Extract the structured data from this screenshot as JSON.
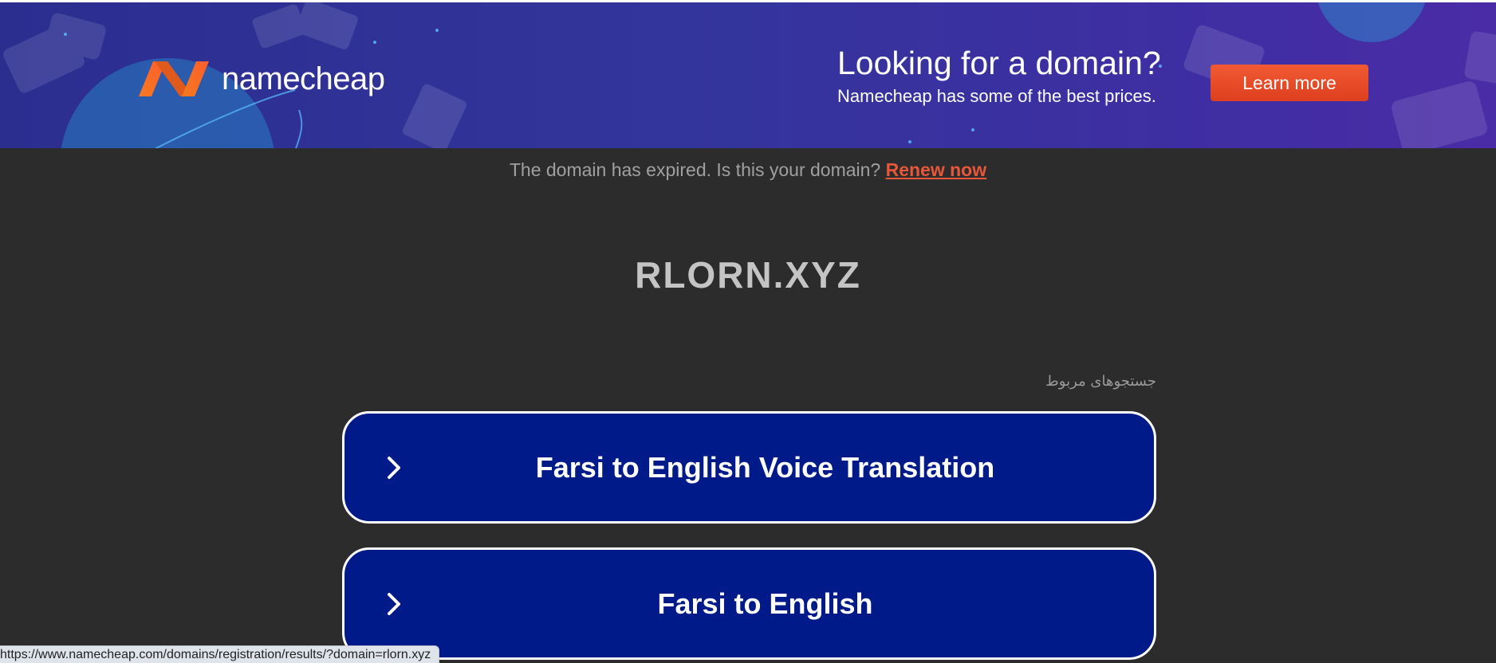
{
  "banner": {
    "brand": "namecheap",
    "logo_icon": "namecheap-n-logo",
    "promo_title": "Looking for a domain?",
    "promo_subtitle": "Namecheap has some of the best prices.",
    "cta_label": "Learn more",
    "colors": {
      "background": "#33359c",
      "cta": "#e94b28"
    }
  },
  "notice": {
    "text": "The domain has expired. Is this your domain?",
    "renew_label": "Renew now"
  },
  "domain": {
    "name": "RLORN.XYZ"
  },
  "related": {
    "label": "جستجوهای مربوط",
    "items": [
      {
        "label": "Farsi to English Voice Translation",
        "icon": "chevron-right-icon"
      },
      {
        "label": "Farsi to English",
        "icon": "chevron-right-icon"
      }
    ]
  },
  "status_bar": {
    "url": "https://www.namecheap.com/domains/registration/results/?domain=rlorn.xyz"
  }
}
